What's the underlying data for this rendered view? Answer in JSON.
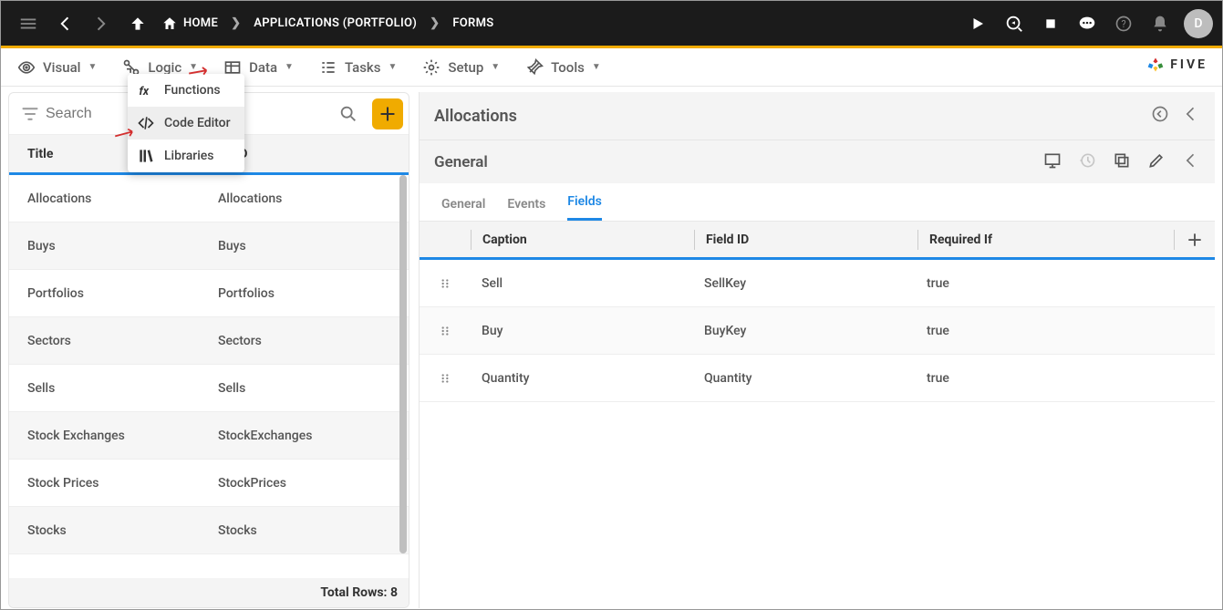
{
  "topbar": {
    "breadcrumb": [
      {
        "label": "HOME",
        "icon": "home"
      },
      {
        "label": "APPLICATIONS (PORTFOLIO)"
      },
      {
        "label": "FORMS"
      }
    ],
    "avatar_initial": "D"
  },
  "toolbar": {
    "items": [
      {
        "label": "Visual",
        "icon": "eye"
      },
      {
        "label": "Logic",
        "icon": "flow"
      },
      {
        "label": "Data",
        "icon": "table"
      },
      {
        "label": "Tasks",
        "icon": "checklist"
      },
      {
        "label": "Setup",
        "icon": "gear"
      },
      {
        "label": "Tools",
        "icon": "wrench"
      }
    ],
    "brand": "FIVE"
  },
  "logic_dropdown": {
    "items": [
      {
        "label": "Functions",
        "icon": "fx"
      },
      {
        "label": "Code Editor",
        "icon": "code",
        "highlight": true
      },
      {
        "label": "Libraries",
        "icon": "library"
      }
    ]
  },
  "left": {
    "search_placeholder": "Search",
    "columns": {
      "title": "Title",
      "uid": "on ID"
    },
    "rows": [
      {
        "title": "Allocations",
        "uid": "Allocations"
      },
      {
        "title": "Buys",
        "uid": "Buys"
      },
      {
        "title": "Portfolios",
        "uid": "Portfolios"
      },
      {
        "title": "Sectors",
        "uid": "Sectors"
      },
      {
        "title": "Sells",
        "uid": "Sells"
      },
      {
        "title": "Stock Exchanges",
        "uid": "StockExchanges"
      },
      {
        "title": "Stock Prices",
        "uid": "StockPrices"
      },
      {
        "title": "Stocks",
        "uid": "Stocks"
      }
    ],
    "footer": "Total Rows: 8"
  },
  "right": {
    "title": "Allocations",
    "subtitle": "General",
    "tabs": [
      "General",
      "Events",
      "Fields"
    ],
    "active_tab": "Fields",
    "columns": {
      "caption": "Caption",
      "field_id": "Field ID",
      "required_if": "Required If"
    },
    "rows": [
      {
        "caption": "Sell",
        "field_id": "SellKey",
        "required_if": "true"
      },
      {
        "caption": "Buy",
        "field_id": "BuyKey",
        "required_if": "true"
      },
      {
        "caption": "Quantity",
        "field_id": "Quantity",
        "required_if": "true"
      }
    ]
  },
  "colors": {
    "accent_yellow": "#f0ab00",
    "accent_blue": "#1e88e5"
  }
}
